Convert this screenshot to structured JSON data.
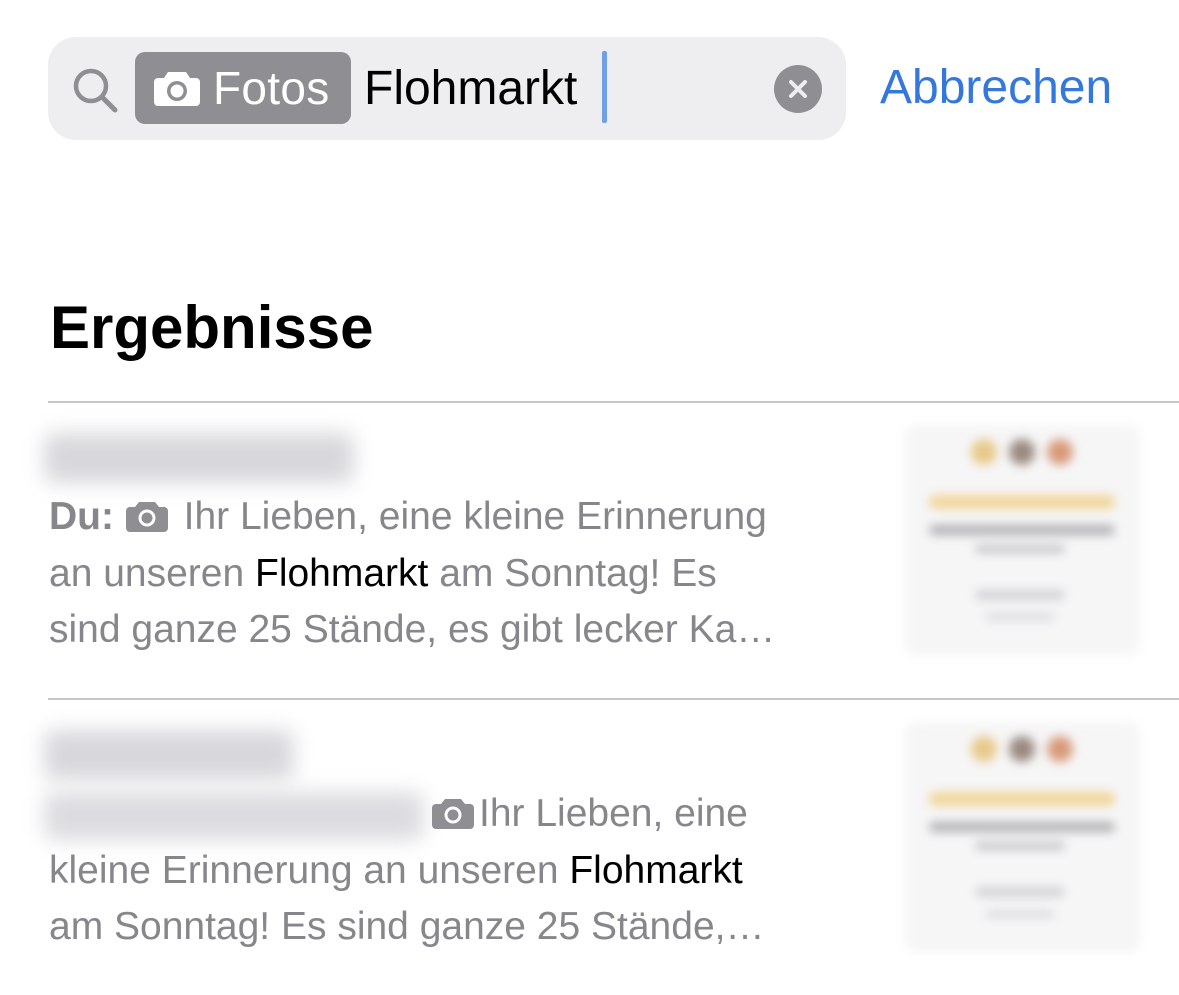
{
  "search": {
    "scope_label": "Fotos",
    "query": "Flohmarkt",
    "cancel_label": "Abbrechen"
  },
  "section": {
    "title": "Ergebnisse"
  },
  "results": [
    {
      "sender_prefix": "Du:",
      "snippet_lines": [
        [
          "Ihr Lieben, eine kleine Erinnerung"
        ],
        [
          "an unseren ",
          "Flohmarkt",
          " am Sonntag! Es"
        ],
        [
          "sind ganze 25 Stände, es gibt lecker Ka…"
        ]
      ],
      "text_before": "Ihr Lieben, eine kleine Erinnerung an unseren ",
      "highlight": "Flohmarkt",
      "text_after": " am Sonntag! Es sind ganze 25 Stände, es gibt lecker Ka…"
    },
    {
      "text_before_line1": "Ihr Lieben, eine",
      "text_before_line2": "kleine Erinnerung an unseren ",
      "highlight": "Flohmarkt",
      "text_after": "am Sonntag! Es sind ganze 25 Stände,…"
    }
  ],
  "colors": {
    "accent": "#3478dc",
    "secondary_text": "#86868b",
    "search_field_bg": "#eeeef0",
    "token_bg": "#8e8e93"
  },
  "icons": {
    "search": "magnifying-glass",
    "scope": "camera",
    "clear": "x-circle-fill",
    "attachment": "camera"
  }
}
